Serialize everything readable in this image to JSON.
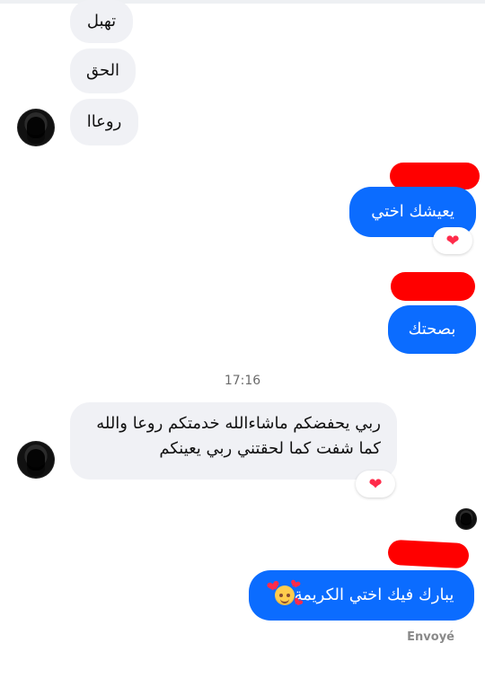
{
  "conversation": {
    "messages": [
      {
        "from": "other",
        "text": "تهبل"
      },
      {
        "from": "other",
        "text": "الحق"
      },
      {
        "from": "other",
        "text": "روعاا"
      },
      {
        "from": "me",
        "text": "يعيشك اختي"
      },
      {
        "from": "me",
        "text": "بصحتك"
      },
      {
        "from": "other",
        "text_lines": [
          "ربي يحفضكم ماشاءالله خدمتكم روعا والله",
          "كما شفت كما لحقتني ربي يعينكم"
        ]
      },
      {
        "from": "me",
        "text": "يبارك فيك اختي الكريمة"
      }
    ],
    "timestamp": "17:16",
    "status": "Envoyé"
  },
  "reactions": {
    "heart": "❤",
    "color": "#ff2b4a"
  },
  "colors": {
    "incoming_bubble": "#f0f1f5",
    "outgoing_bubble": "#0b6cff",
    "redaction": "#ff0000"
  },
  "icons": {
    "reaction_icon": "heart-icon",
    "emoji_icon": "smiling-face-with-hearts-icon"
  }
}
